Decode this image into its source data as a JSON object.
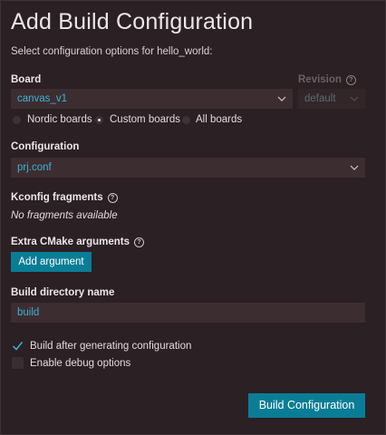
{
  "dialog": {
    "title": "Add Build Configuration",
    "subtitle": "Select configuration options for hello_world:"
  },
  "board": {
    "label": "Board",
    "selected": "canvas_v1",
    "revision_label": "Revision",
    "revision_selected": "default",
    "filter_options": [
      {
        "label": "Nordic boards",
        "checked": false
      },
      {
        "label": "Custom boards",
        "checked": true
      },
      {
        "label": "All boards",
        "checked": false
      }
    ]
  },
  "configuration": {
    "label": "Configuration",
    "selected": "prj.conf"
  },
  "kconfig": {
    "label": "Kconfig fragments",
    "empty_text": "No fragments available"
  },
  "cmake": {
    "label": "Extra CMake arguments",
    "add_button": "Add argument"
  },
  "build_dir": {
    "label": "Build directory name",
    "value": "build"
  },
  "options": [
    {
      "label": "Build after generating configuration",
      "checked": true
    },
    {
      "label": "Enable debug options",
      "checked": false
    }
  ],
  "submit_button": "Build Configuration",
  "colors": {
    "background": "#2b2023",
    "accent": "#0a7d96",
    "link_text": "#3fb1d4",
    "field_bg": "#3c2d31"
  },
  "icons": {
    "help": "question-circle-icon",
    "dropdown": "chevron-down-icon",
    "check": "checkmark-icon"
  }
}
